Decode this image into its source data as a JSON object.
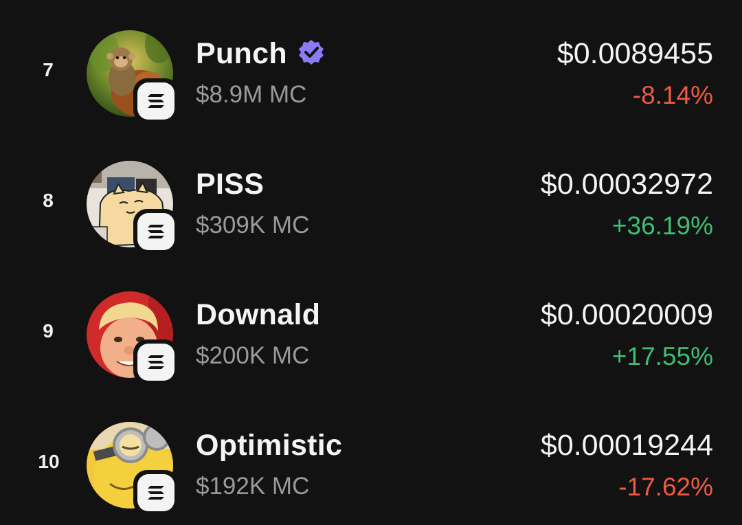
{
  "colors": {
    "background": "#121212",
    "positive": "#3fbf74",
    "negative": "#ef5a44",
    "verified": "#8b7cf6",
    "muted": "#9a9a9a"
  },
  "tokens": [
    {
      "rank": "7",
      "name": "Punch",
      "verified": true,
      "market_cap": "$8.9M MC",
      "price": "$0.0089455",
      "change": "-8.14%",
      "direction": "negative",
      "avatar_icon": "monkey-avatar-icon",
      "chain_icon": "solana-chain-icon"
    },
    {
      "rank": "8",
      "name": "PISS",
      "verified": false,
      "market_cap": "$309K MC",
      "price": "$0.00032972",
      "change": "+36.19%",
      "direction": "positive",
      "avatar_icon": "cartoon-cat-avatar-icon",
      "chain_icon": "solana-chain-icon"
    },
    {
      "rank": "9",
      "name": "Downald",
      "verified": false,
      "market_cap": "$200K MC",
      "price": "$0.00020009",
      "change": "+17.55%",
      "direction": "positive",
      "avatar_icon": "face-avatar-icon",
      "chain_icon": "solana-chain-icon"
    },
    {
      "rank": "10",
      "name": "Optimistic",
      "verified": false,
      "market_cap": "$192K MC",
      "price": "$0.00019244",
      "change": "-17.62%",
      "direction": "negative",
      "avatar_icon": "minion-avatar-icon",
      "chain_icon": "solana-chain-icon"
    }
  ]
}
